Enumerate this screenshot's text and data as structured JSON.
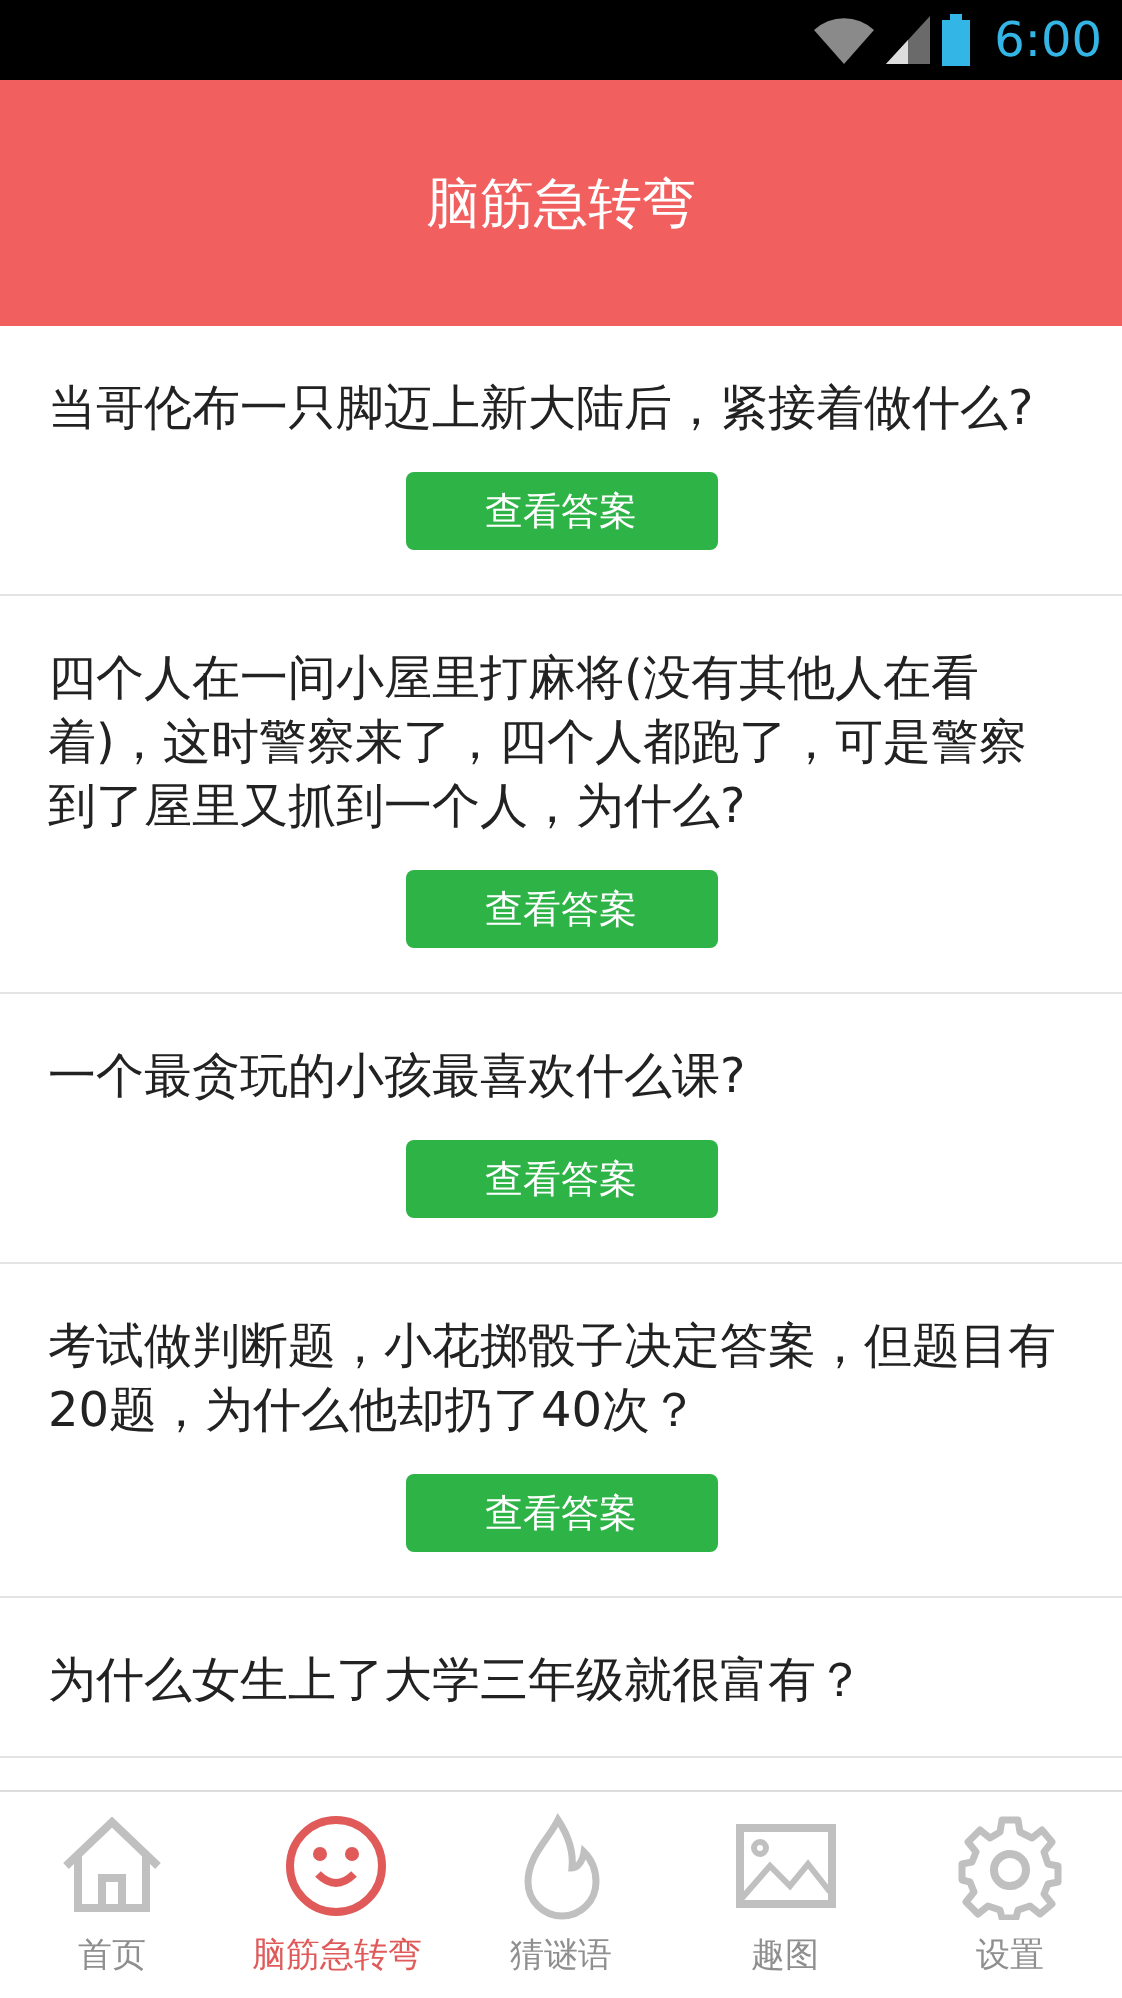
{
  "status_bar": {
    "time": "6:00"
  },
  "header": {
    "title": "脑筋急转弯"
  },
  "questions": [
    {
      "text": "当哥伦布一只脚迈上新大陆后，紧接着做什么?",
      "button": "查看答案"
    },
    {
      "text": "四个人在一间小屋里打麻将(没有其他人在看着)，这时警察来了，四个人都跑了，可是警察到了屋里又抓到一个人，为什么?",
      "button": "查看答案"
    },
    {
      "text": "一个最贪玩的小孩最喜欢什么课?",
      "button": "查看答案"
    },
    {
      "text": "考试做判断题，小花掷骰子决定答案，但题目有20题，为什么他却扔了40次？",
      "button": "查看答案"
    },
    {
      "text": "为什么女生上了大学三年级就很富有？"
    }
  ],
  "tabs": [
    {
      "kind": "home",
      "label": "首页",
      "selected": false
    },
    {
      "kind": "smile",
      "label": "脑筋急转弯",
      "selected": true
    },
    {
      "kind": "flame",
      "label": "猜谜语",
      "selected": false
    },
    {
      "kind": "image",
      "label": "趣图",
      "selected": false
    },
    {
      "kind": "gear",
      "label": "设置",
      "selected": false
    }
  ]
}
